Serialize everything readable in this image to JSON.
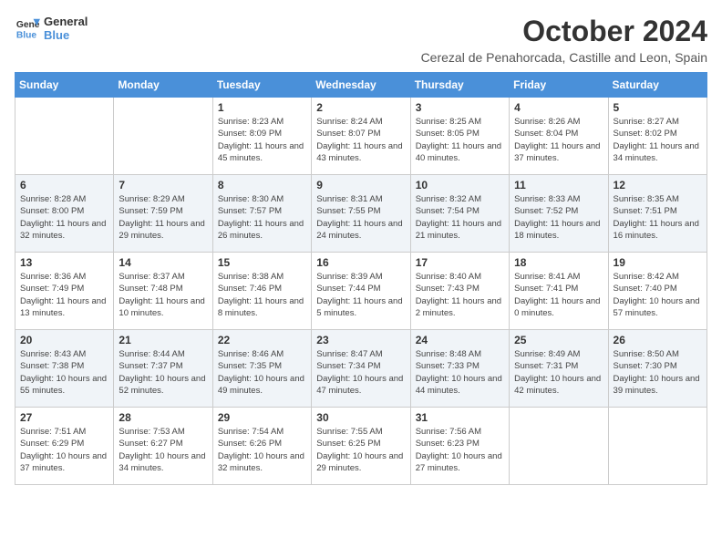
{
  "header": {
    "logo_line1": "General",
    "logo_line2": "Blue",
    "month_title": "October 2024",
    "subtitle": "Cerezal de Penahorcada, Castille and Leon, Spain"
  },
  "days_of_week": [
    "Sunday",
    "Monday",
    "Tuesday",
    "Wednesday",
    "Thursday",
    "Friday",
    "Saturday"
  ],
  "weeks": [
    [
      {
        "day": "",
        "info": ""
      },
      {
        "day": "",
        "info": ""
      },
      {
        "day": "1",
        "info": "Sunrise: 8:23 AM\nSunset: 8:09 PM\nDaylight: 11 hours and 45 minutes."
      },
      {
        "day": "2",
        "info": "Sunrise: 8:24 AM\nSunset: 8:07 PM\nDaylight: 11 hours and 43 minutes."
      },
      {
        "day": "3",
        "info": "Sunrise: 8:25 AM\nSunset: 8:05 PM\nDaylight: 11 hours and 40 minutes."
      },
      {
        "day": "4",
        "info": "Sunrise: 8:26 AM\nSunset: 8:04 PM\nDaylight: 11 hours and 37 minutes."
      },
      {
        "day": "5",
        "info": "Sunrise: 8:27 AM\nSunset: 8:02 PM\nDaylight: 11 hours and 34 minutes."
      }
    ],
    [
      {
        "day": "6",
        "info": "Sunrise: 8:28 AM\nSunset: 8:00 PM\nDaylight: 11 hours and 32 minutes."
      },
      {
        "day": "7",
        "info": "Sunrise: 8:29 AM\nSunset: 7:59 PM\nDaylight: 11 hours and 29 minutes."
      },
      {
        "day": "8",
        "info": "Sunrise: 8:30 AM\nSunset: 7:57 PM\nDaylight: 11 hours and 26 minutes."
      },
      {
        "day": "9",
        "info": "Sunrise: 8:31 AM\nSunset: 7:55 PM\nDaylight: 11 hours and 24 minutes."
      },
      {
        "day": "10",
        "info": "Sunrise: 8:32 AM\nSunset: 7:54 PM\nDaylight: 11 hours and 21 minutes."
      },
      {
        "day": "11",
        "info": "Sunrise: 8:33 AM\nSunset: 7:52 PM\nDaylight: 11 hours and 18 minutes."
      },
      {
        "day": "12",
        "info": "Sunrise: 8:35 AM\nSunset: 7:51 PM\nDaylight: 11 hours and 16 minutes."
      }
    ],
    [
      {
        "day": "13",
        "info": "Sunrise: 8:36 AM\nSunset: 7:49 PM\nDaylight: 11 hours and 13 minutes."
      },
      {
        "day": "14",
        "info": "Sunrise: 8:37 AM\nSunset: 7:48 PM\nDaylight: 11 hours and 10 minutes."
      },
      {
        "day": "15",
        "info": "Sunrise: 8:38 AM\nSunset: 7:46 PM\nDaylight: 11 hours and 8 minutes."
      },
      {
        "day": "16",
        "info": "Sunrise: 8:39 AM\nSunset: 7:44 PM\nDaylight: 11 hours and 5 minutes."
      },
      {
        "day": "17",
        "info": "Sunrise: 8:40 AM\nSunset: 7:43 PM\nDaylight: 11 hours and 2 minutes."
      },
      {
        "day": "18",
        "info": "Sunrise: 8:41 AM\nSunset: 7:41 PM\nDaylight: 11 hours and 0 minutes."
      },
      {
        "day": "19",
        "info": "Sunrise: 8:42 AM\nSunset: 7:40 PM\nDaylight: 10 hours and 57 minutes."
      }
    ],
    [
      {
        "day": "20",
        "info": "Sunrise: 8:43 AM\nSunset: 7:38 PM\nDaylight: 10 hours and 55 minutes."
      },
      {
        "day": "21",
        "info": "Sunrise: 8:44 AM\nSunset: 7:37 PM\nDaylight: 10 hours and 52 minutes."
      },
      {
        "day": "22",
        "info": "Sunrise: 8:46 AM\nSunset: 7:35 PM\nDaylight: 10 hours and 49 minutes."
      },
      {
        "day": "23",
        "info": "Sunrise: 8:47 AM\nSunset: 7:34 PM\nDaylight: 10 hours and 47 minutes."
      },
      {
        "day": "24",
        "info": "Sunrise: 8:48 AM\nSunset: 7:33 PM\nDaylight: 10 hours and 44 minutes."
      },
      {
        "day": "25",
        "info": "Sunrise: 8:49 AM\nSunset: 7:31 PM\nDaylight: 10 hours and 42 minutes."
      },
      {
        "day": "26",
        "info": "Sunrise: 8:50 AM\nSunset: 7:30 PM\nDaylight: 10 hours and 39 minutes."
      }
    ],
    [
      {
        "day": "27",
        "info": "Sunrise: 7:51 AM\nSunset: 6:29 PM\nDaylight: 10 hours and 37 minutes."
      },
      {
        "day": "28",
        "info": "Sunrise: 7:53 AM\nSunset: 6:27 PM\nDaylight: 10 hours and 34 minutes."
      },
      {
        "day": "29",
        "info": "Sunrise: 7:54 AM\nSunset: 6:26 PM\nDaylight: 10 hours and 32 minutes."
      },
      {
        "day": "30",
        "info": "Sunrise: 7:55 AM\nSunset: 6:25 PM\nDaylight: 10 hours and 29 minutes."
      },
      {
        "day": "31",
        "info": "Sunrise: 7:56 AM\nSunset: 6:23 PM\nDaylight: 10 hours and 27 minutes."
      },
      {
        "day": "",
        "info": ""
      },
      {
        "day": "",
        "info": ""
      }
    ]
  ]
}
